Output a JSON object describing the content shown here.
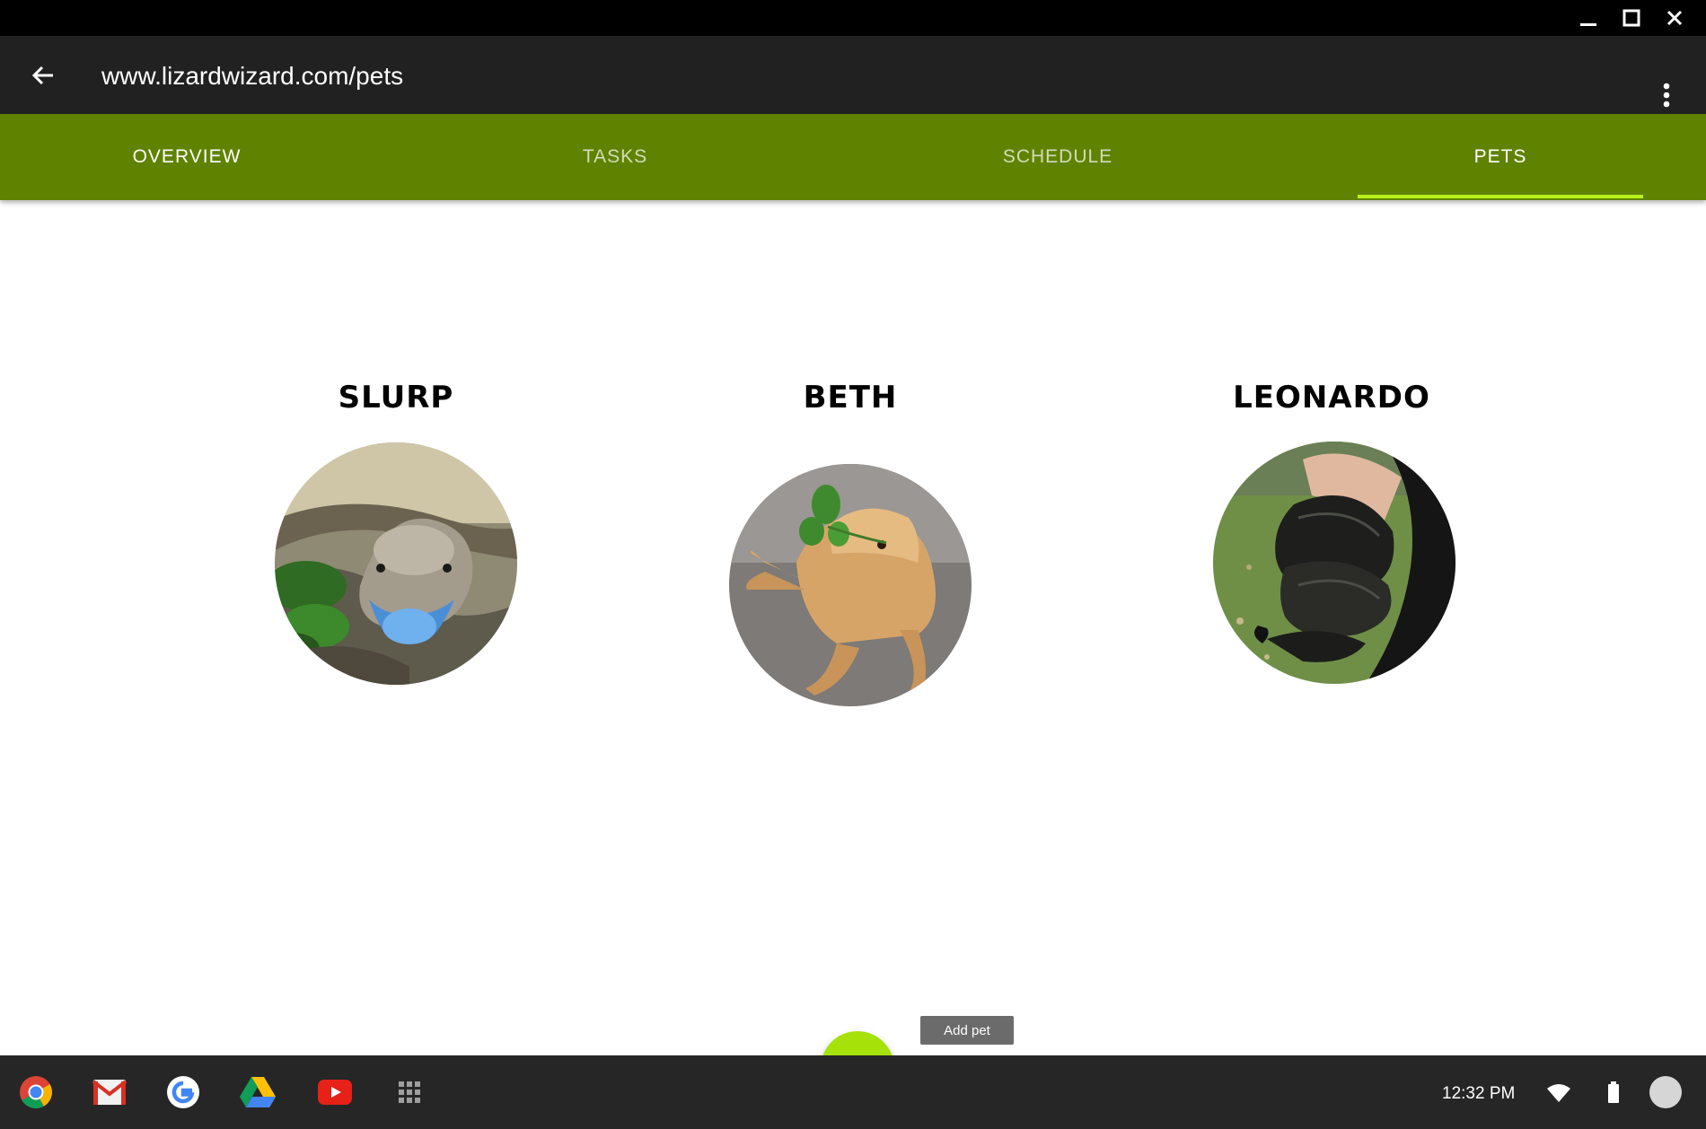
{
  "window": {
    "controls": [
      "minimize-icon",
      "maximize-icon",
      "close-icon"
    ]
  },
  "appbar": {
    "url": "www.lizardwizard.com/pets",
    "back_icon": "arrow-left-icon",
    "menu_icon": "more-vert-icon"
  },
  "tabs": [
    {
      "label": "OVERVIEW",
      "active": false
    },
    {
      "label": "TASKS",
      "active": false
    },
    {
      "label": "SCHEDULE",
      "active": false
    },
    {
      "label": "PETS",
      "active": true
    }
  ],
  "pets": [
    {
      "name": "SLURP",
      "photo": "blue-tongued skink"
    },
    {
      "name": "BETH",
      "photo": "bearded dragon"
    },
    {
      "name": "LEONARDO",
      "photo": "black snake"
    }
  ],
  "fab": {
    "icon": "plus-icon",
    "tooltip": "Add pet"
  },
  "shelf": {
    "apps": [
      "chrome-icon",
      "gmail-icon",
      "google-icon",
      "drive-icon",
      "youtube-icon",
      "app-launcher-icon"
    ],
    "time": "12:32 PM",
    "status_icons": [
      "wifi-icon",
      "battery-icon",
      "account-avatar"
    ]
  },
  "colors": {
    "appbar": "#212121",
    "tabbar": "#5f8200",
    "tab_indicator": "#b8f01c",
    "fab": "#a6e10a",
    "shelf": "#262626"
  }
}
